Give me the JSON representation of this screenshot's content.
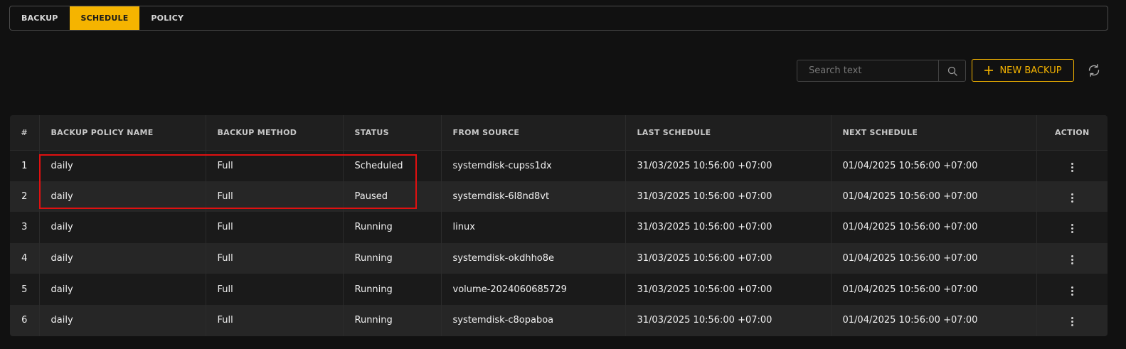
{
  "tabs": [
    {
      "label": "BACKUP",
      "active": false
    },
    {
      "label": "SCHEDULE",
      "active": true
    },
    {
      "label": "POLICY",
      "active": false
    }
  ],
  "toolbar": {
    "search_placeholder": "Search text",
    "search_icon": "search-icon",
    "new_button_label": "NEW BACKUP",
    "new_button_icon": "plus-icon",
    "refresh_icon": "refresh-icon"
  },
  "colors": {
    "accent": "#f5b400",
    "highlight": "#e01010",
    "background": "#111111"
  },
  "table": {
    "headers": [
      "#",
      "BACKUP POLICY NAME",
      "BACKUP METHOD",
      "STATUS",
      "FROM SOURCE",
      "LAST SCHEDULE",
      "NEXT SCHEDULE",
      "ACTION"
    ],
    "rows": [
      {
        "index": "1",
        "policy": "daily",
        "method": "Full",
        "status": "Scheduled",
        "source": "systemdisk-cupss1dx",
        "last": "31/03/2025 10:56:00 +07:00",
        "next": "01/04/2025 10:56:00 +07:00"
      },
      {
        "index": "2",
        "policy": "daily",
        "method": "Full",
        "status": "Paused",
        "source": "systemdisk-6l8nd8vt",
        "last": "31/03/2025 10:56:00 +07:00",
        "next": "01/04/2025 10:56:00 +07:00"
      },
      {
        "index": "3",
        "policy": "daily",
        "method": "Full",
        "status": "Running",
        "source": "linux",
        "last": "31/03/2025 10:56:00 +07:00",
        "next": "01/04/2025 10:56:00 +07:00"
      },
      {
        "index": "4",
        "policy": "daily",
        "method": "Full",
        "status": "Running",
        "source": "systemdisk-okdhho8e",
        "last": "31/03/2025 10:56:00 +07:00",
        "next": "01/04/2025 10:56:00 +07:00"
      },
      {
        "index": "5",
        "policy": "daily",
        "method": "Full",
        "status": "Running",
        "source": "volume-2024060685729",
        "last": "31/03/2025 10:56:00 +07:00",
        "next": "01/04/2025 10:56:00 +07:00"
      },
      {
        "index": "6",
        "policy": "daily",
        "method": "Full",
        "status": "Running",
        "source": "systemdisk-c8opaboa",
        "last": "31/03/2025 10:56:00 +07:00",
        "next": "01/04/2025 10:56:00 +07:00"
      }
    ]
  }
}
